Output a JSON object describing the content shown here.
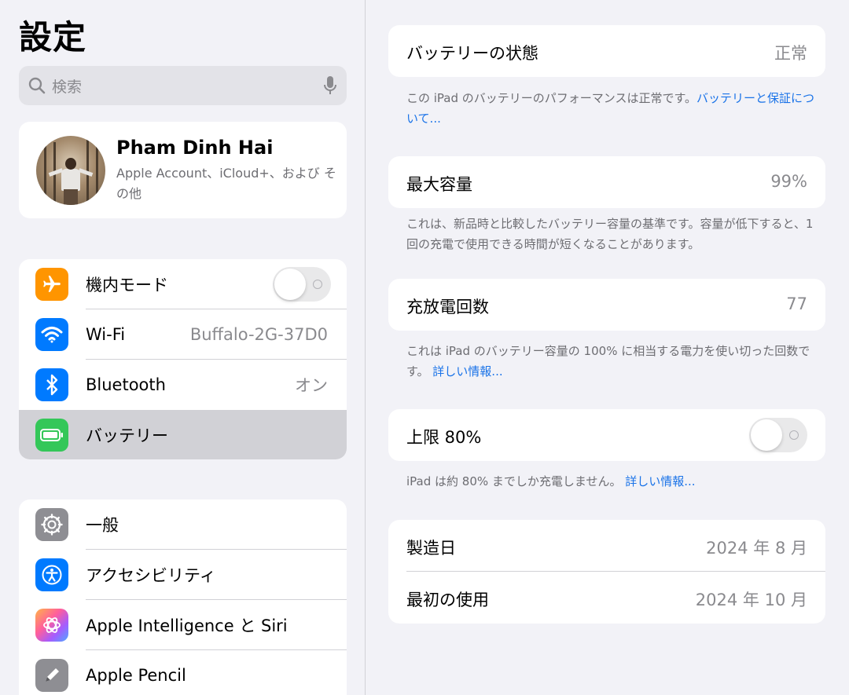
{
  "sidebar": {
    "title": "設定",
    "search_placeholder": "検索",
    "profile": {
      "name": "Pham Dinh Hai",
      "subtitle": "Apple Account、iCloud+、および その他"
    },
    "group1": [
      {
        "label": "機内モード",
        "icon": "airplane-icon",
        "color": "#ff9500",
        "toggle": false
      },
      {
        "label": "Wi-Fi",
        "value": "Buffalo-2G-37D0",
        "icon": "wifi-icon",
        "color": "#007aff"
      },
      {
        "label": "Bluetooth",
        "value": "オン",
        "icon": "bluetooth-icon",
        "color": "#007aff"
      },
      {
        "label": "バッテリー",
        "icon": "battery-icon",
        "color": "#34c759",
        "selected": true
      }
    ],
    "group2": [
      {
        "label": "一般",
        "icon": "gear-icon",
        "color": "#8e8e93"
      },
      {
        "label": "アクセシビリティ",
        "icon": "accessibility-icon",
        "color": "#007aff"
      },
      {
        "label": "Apple Intelligence と Siri",
        "icon": "siri-icon",
        "color": "#ff6b9d"
      },
      {
        "label": "Apple Pencil",
        "icon": "pencil-icon",
        "color": "#8e8e93"
      }
    ]
  },
  "detail": {
    "health": {
      "label": "バッテリーの状態",
      "value": "正常"
    },
    "health_note": "この iPad のバッテリーのパフォーマンスは正常です。",
    "health_link": "バッテリーと保証について...",
    "capacity": {
      "label": "最大容量",
      "value": "99%"
    },
    "capacity_note": "これは、新品時と比較したバッテリー容量の基準です。容量が低下すると、1 回の充電で使用できる時間が短くなることがあります。",
    "cycles": {
      "label": "充放電回数",
      "value": "77"
    },
    "cycles_note": "これは iPad のバッテリー容量の 100% に相当する電力を使い切った回数です。",
    "cycles_link": "詳しい情報...",
    "limit": {
      "label": "上限 80%",
      "toggle": false
    },
    "limit_note": "iPad は約 80% までしか充電しません。",
    "limit_link": "詳しい情報...",
    "manufacture": {
      "label": "製造日",
      "value": "2024 年 8 月"
    },
    "first_use": {
      "label": "最初の使用",
      "value": "2024 年 10 月"
    }
  },
  "colors": {
    "link": "#1a73e8",
    "toggle_off": "#e9e9ea",
    "selected_row": "#d1d1d6"
  }
}
